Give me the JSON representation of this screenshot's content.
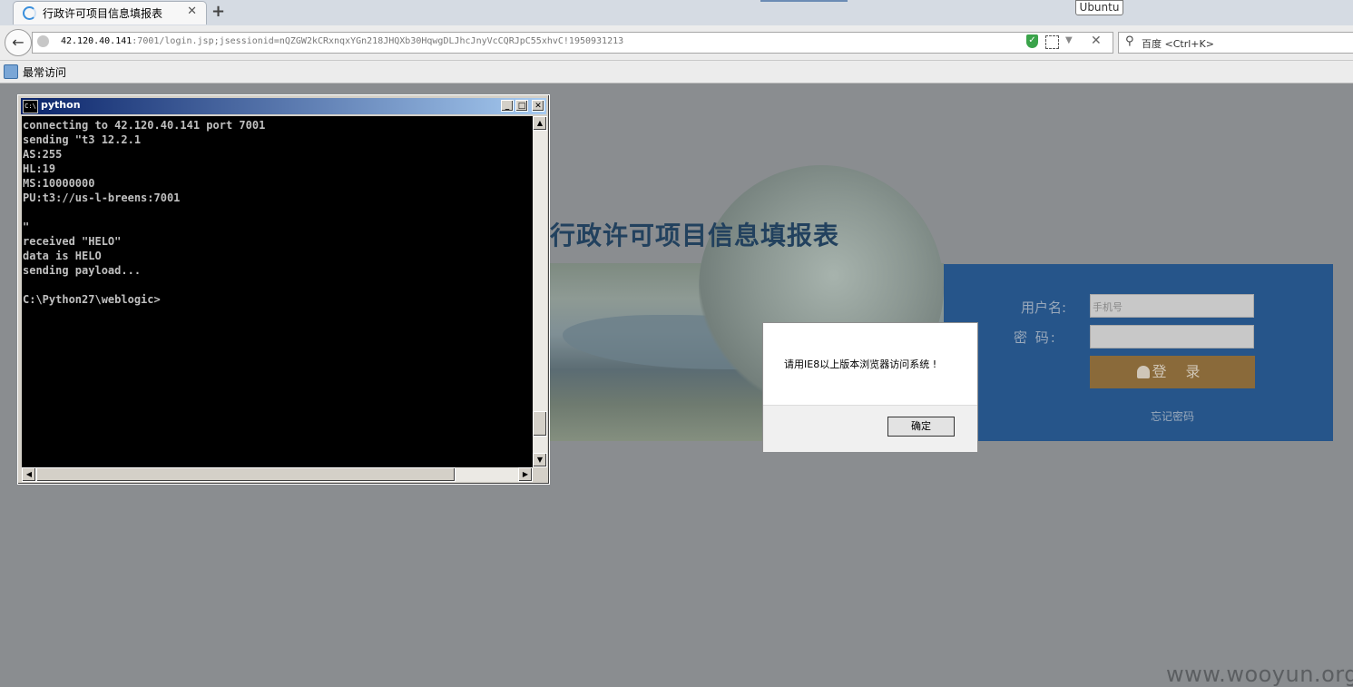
{
  "browser": {
    "tab_title": "行政许可项目信息填报表",
    "tab_close": "✕",
    "new_tab": "+",
    "tooltip": "Ubuntu",
    "url_host": "42.120.40.141",
    "url_rest": ":7001/login.jsp;jsessionid=nQZGW2kCRxnqxYGn218JHQXb30HqwgDLJhcJnyVcCQRJpC55xhvC!1950931213",
    "search_placeholder": "百度 <Ctrl+K>",
    "bookmark_label": "最常访问",
    "icons": [
      "spinner-icon",
      "back-arrow-icon",
      "globe-icon",
      "shield-icon",
      "qr-code-icon",
      "dropdown-icon",
      "stop-icon",
      "search-icon",
      "bookmark-folder-icon"
    ]
  },
  "page": {
    "banner_title": "行政许可项目信息填报表",
    "username_label": "用户名:",
    "username_placeholder": "手机号",
    "password_label": "密  码:",
    "login_button": "登 录",
    "forgot_password": "忘记密码"
  },
  "dialog": {
    "message": "请用IE8以上版本浏览器访问系统 !",
    "ok_button": "确定"
  },
  "console": {
    "title": "python",
    "icon_text": "C:\\",
    "lines": "connecting to 42.120.40.141 port 7001\nsending \"t3 12.2.1\nAS:255\nHL:19\nMS:10000000\nPU:t3://us-l-breens:7001\n\n\"\nreceived \"HELO\"\ndata is HELO\nsending payload...\n\nC:\\Python27\\weblogic>",
    "minimize": "_",
    "maximize": "□",
    "close": "✕",
    "scroll_up": "▲",
    "scroll_down": "▼",
    "scroll_left": "◀",
    "scroll_right": "▶"
  },
  "watermark": "www.wooyun.org"
}
